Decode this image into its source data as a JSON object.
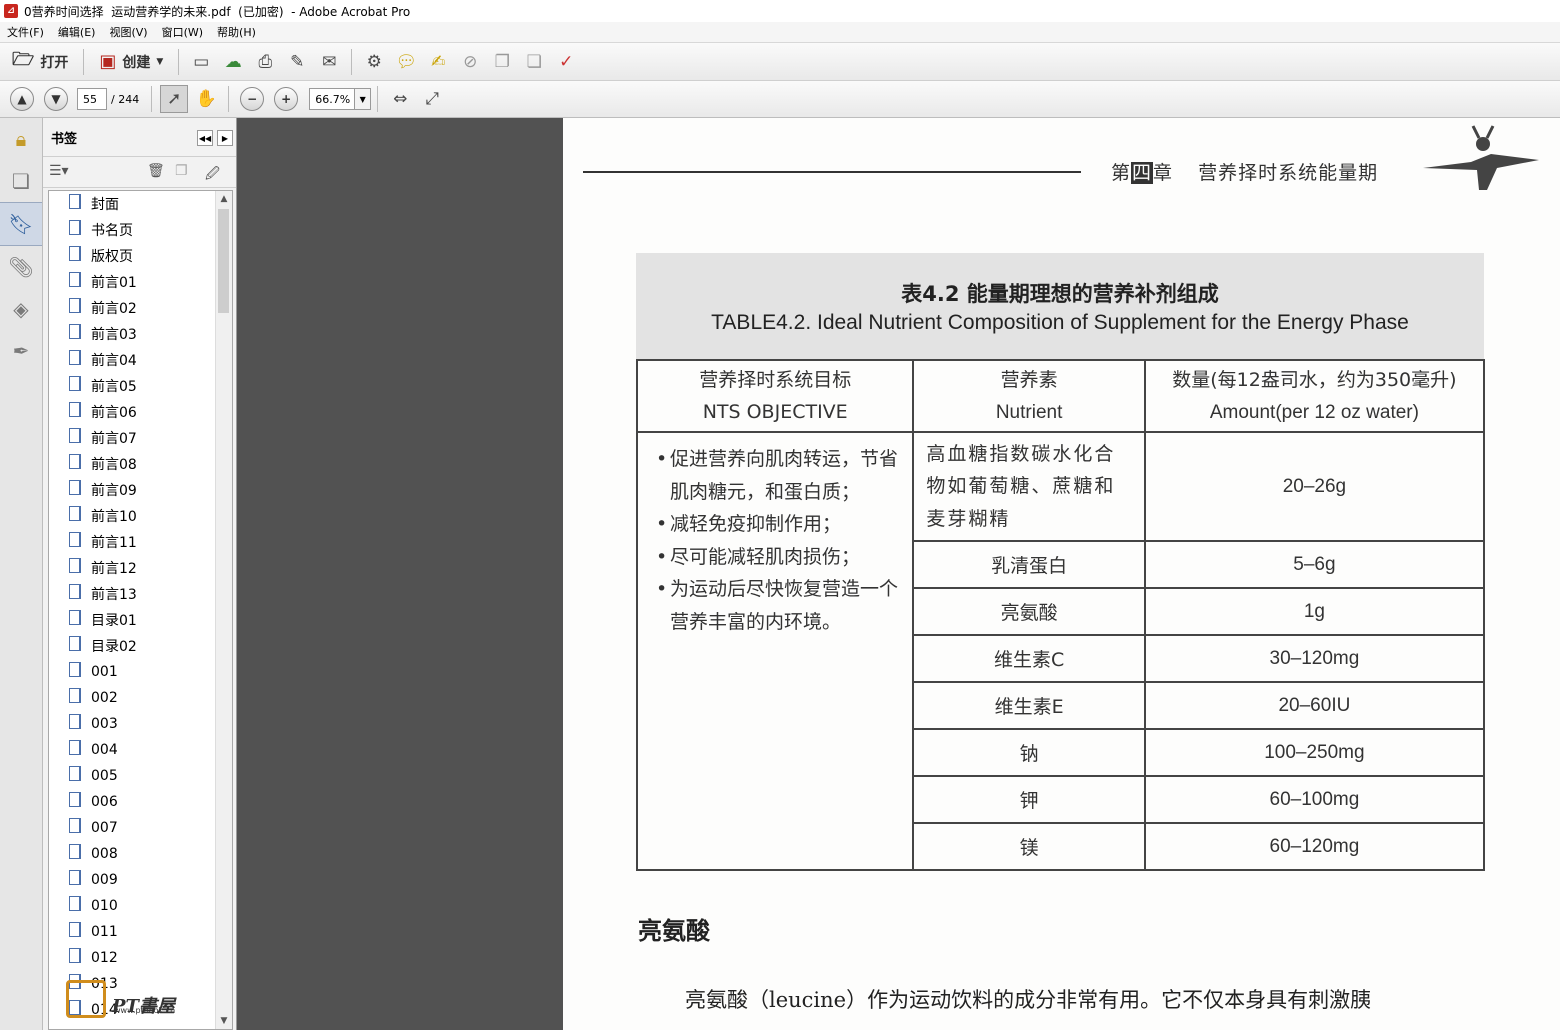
{
  "window": {
    "title": "0营养时间选择  运动营养学的未来.pdf  (已加密)  - Adobe Acrobat Pro",
    "app_icon": "pdf-icon"
  },
  "menu": [
    "文件(F)",
    "编辑(E)",
    "视图(V)",
    "窗口(W)",
    "帮助(H)"
  ],
  "toolbar": {
    "open_label": "打开",
    "create_label": "创建",
    "icons": [
      "save-icon",
      "upload-icon",
      "print-icon",
      "edit-icon",
      "email-icon",
      "settings-icon",
      "comment-icon",
      "sign-icon",
      "secure-icon",
      "export-icon",
      "compare-icon",
      "review-icon"
    ]
  },
  "nav": {
    "page_current": "55",
    "page_total": "/ 244",
    "zoom": "66.7%"
  },
  "bookmarks": {
    "title": "书签",
    "items": [
      "封面",
      "书名页",
      "版权页",
      "前言01",
      "前言02",
      "前言03",
      "前言04",
      "前言05",
      "前言06",
      "前言07",
      "前言08",
      "前言09",
      "前言10",
      "前言11",
      "前言12",
      "前言13",
      "目录01",
      "目录02",
      "001",
      "002",
      "003",
      "004",
      "005",
      "006",
      "007",
      "008",
      "009",
      "010",
      "011",
      "012",
      "013",
      "014"
    ]
  },
  "watermark": {
    "title": "PT書屋",
    "url": "www.ptbook.cn"
  },
  "page": {
    "header_prefix": "第",
    "header_highlight": "四",
    "header_suffix": "章",
    "header_title": "营养择时系统能量期",
    "table_title_cn": "表4.2  能量期理想的营养补剂组成",
    "table_title_en": "TABLE4.2. Ideal Nutrient Composition of Supplement for the Energy Phase",
    "col1_cn": "营养择时系统目标",
    "col1_en": "NTS OBJECTIVE",
    "col2_cn": "营养素",
    "col2_en": "Nutrient",
    "col3_cn": "数量(每12盎司水，约为350毫升)",
    "col3_en": "Amount(per 12 oz water)",
    "objectives": [
      "促进营养向肌肉转运，节省肌肉糖元，和蛋白质；",
      "减轻免疫抑制作用；",
      "尽可能减轻肌肉损伤；",
      "为运动后尽快恢复营造一个营养丰富的内环境。"
    ],
    "rows": [
      {
        "nutrient": "高血糖指数碳水化合物如葡萄糖、蔗糖和麦芽糊精",
        "amount": "20–26g"
      },
      {
        "nutrient": "乳清蛋白",
        "amount": "5–6g"
      },
      {
        "nutrient": "亮氨酸",
        "amount": "1g"
      },
      {
        "nutrient": "维生素C",
        "amount": "30–120mg"
      },
      {
        "nutrient": "维生素E",
        "amount": "20–60IU"
      },
      {
        "nutrient": "钠",
        "amount": "100–250mg"
      },
      {
        "nutrient": "钾",
        "amount": "60–100mg"
      },
      {
        "nutrient": "镁",
        "amount": "60–120mg"
      }
    ],
    "section_heading": "亮氨酸",
    "paragraph": "亮氨酸（leucine）作为运动饮料的成分非常有用。它不仅本身具有刺激胰"
  }
}
